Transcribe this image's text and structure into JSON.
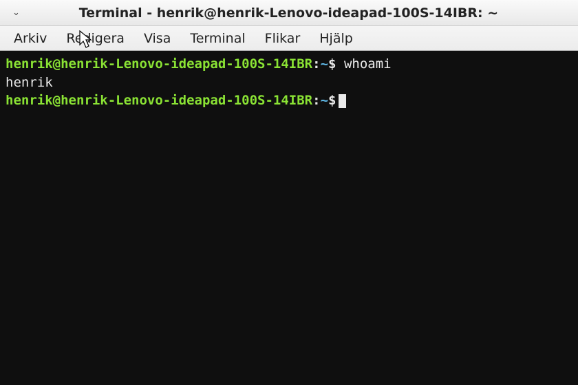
{
  "window": {
    "title": "Terminal - henrik@henrik-Lenovo-ideapad-100S-14IBR: ~",
    "arrow_glyph": "⌄"
  },
  "menu": {
    "arkiv": "Arkiv",
    "redigera": "Redigera",
    "visa": "Visa",
    "terminal": "Terminal",
    "flikar": "Flikar",
    "hjalp": "Hjälp"
  },
  "prompt": {
    "userhost": "henrik@henrik-Lenovo-ideapad-100S-14IBR",
    "colon": ":",
    "path": "~",
    "sigil": "$"
  },
  "line1_cmd": "whoami",
  "line2_output": "henrik"
}
